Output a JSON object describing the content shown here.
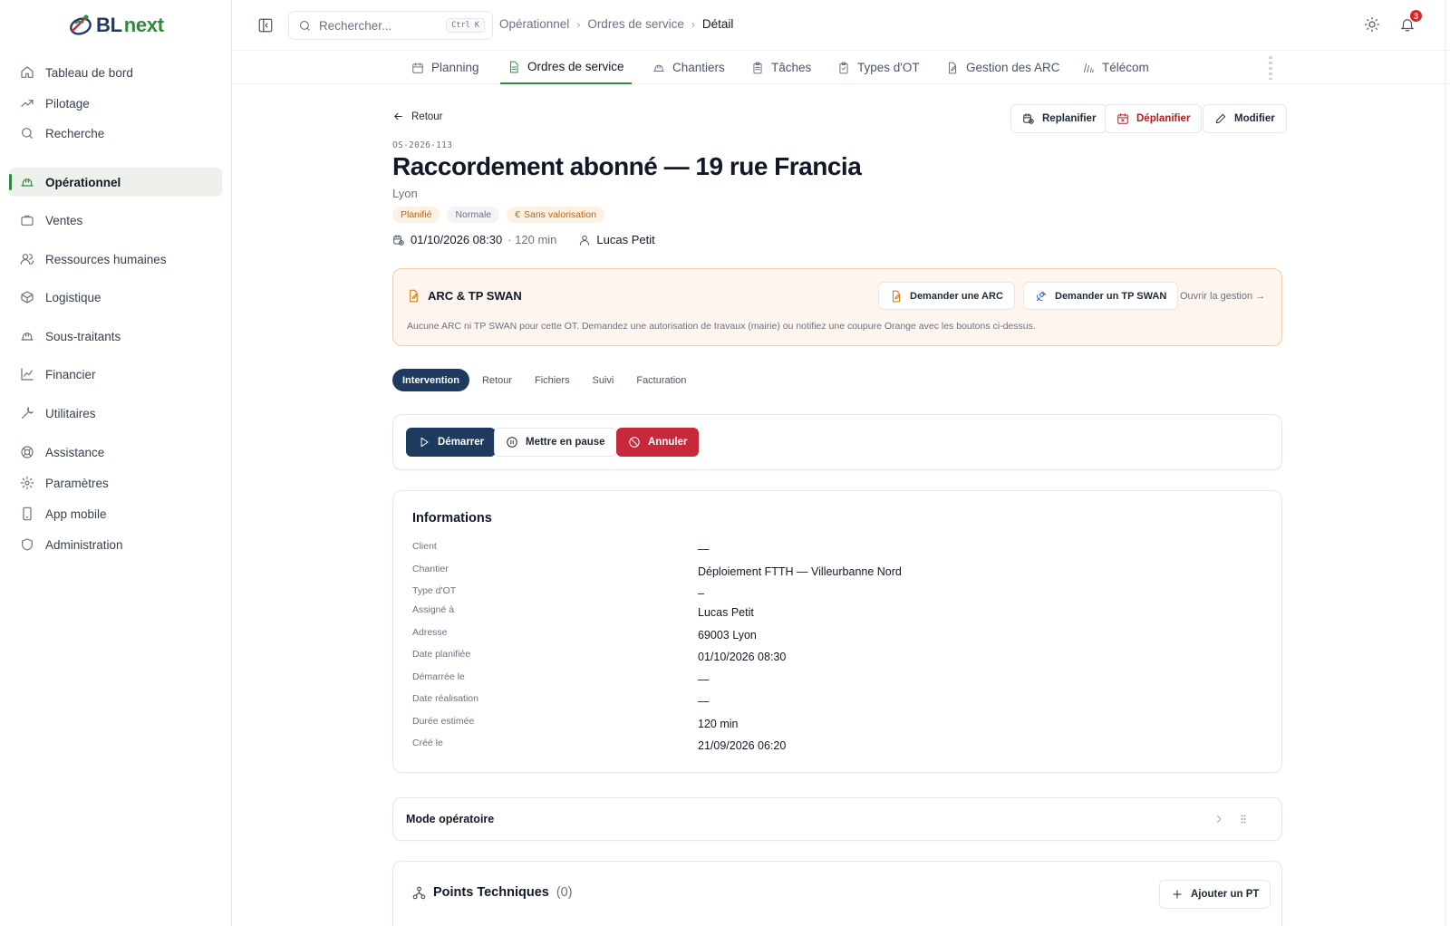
{
  "app": {
    "brand_prefix": "BL",
    "brand_suffix": "next",
    "accent": "#2f8a3c",
    "navy": "#1f3a5f"
  },
  "sidebar": {
    "items": [
      {
        "label": "Tableau de bord",
        "icon": "home-icon"
      },
      {
        "label": "Pilotage",
        "icon": "trend-icon"
      },
      {
        "label": "Recherche",
        "icon": "search-icon"
      },
      {
        "label": "Opérationnel",
        "icon": "hard-hat-icon",
        "active": true
      },
      {
        "label": "Ventes",
        "icon": "briefcase-icon"
      },
      {
        "label": "Ressources humaines",
        "icon": "users-icon"
      },
      {
        "label": "Logistique",
        "icon": "package-icon"
      },
      {
        "label": "Sous-traitants",
        "icon": "hard-hat-icon"
      },
      {
        "label": "Financier",
        "icon": "chart-line-icon"
      },
      {
        "label": "Utilitaires",
        "icon": "wrench-icon"
      },
      {
        "label": "Assistance",
        "icon": "lifebuoy-icon"
      },
      {
        "label": "Paramètres",
        "icon": "gear-icon"
      },
      {
        "label": "App mobile",
        "icon": "phone-icon"
      },
      {
        "label": "Administration",
        "icon": "shield-icon"
      }
    ]
  },
  "topbar": {
    "search_placeholder": "Rechercher...",
    "search_shortcut": "Ctrl K",
    "breadcrumb": [
      "Opérationnel",
      "Ordres de service",
      "Détail"
    ],
    "notifications_count": "3"
  },
  "subnav": {
    "tabs": [
      {
        "label": "Planning",
        "icon": "calendar-icon"
      },
      {
        "label": "Ordres de service",
        "icon": "file-icon",
        "active": true
      },
      {
        "label": "Chantiers",
        "icon": "hard-hat-icon"
      },
      {
        "label": "Tâches",
        "icon": "clipboard-icon"
      },
      {
        "label": "Types d'OT",
        "icon": "clipboard-check-icon"
      },
      {
        "label": "Gestion des ARC",
        "icon": "file-edit-icon"
      },
      {
        "label": "Télécom",
        "icon": "signal-icon"
      }
    ]
  },
  "order": {
    "back_label": "Retour",
    "actions": {
      "replan": "Replanifier",
      "unplan": "Déplanifier",
      "edit": "Modifier"
    },
    "reference": "OS-2026-113",
    "title": "Raccordement abonné — 19 rue Francia",
    "city": "Lyon",
    "badges": {
      "status": "Planifié",
      "priority": "Normale",
      "valuation": "Sans valorisation",
      "valuation_symbol": "€"
    },
    "meta": {
      "datetime": "01/10/2026 08:30",
      "duration": "· 120 min",
      "assignee": "Lucas Petit"
    }
  },
  "arc": {
    "title": "ARC & TP SWAN",
    "request_arc": "Demander une ARC",
    "request_swan": "Demander un TP SWAN",
    "open_link": "Ouvrir la gestion →",
    "description": "Aucune ARC ni TP SWAN pour cette OT. Demandez une autorisation de travaux (mairie) ou notifiez une coupure Orange avec les boutons ci-dessus."
  },
  "detail_tabs": [
    {
      "label": "Intervention",
      "active": true
    },
    {
      "label": "Retour"
    },
    {
      "label": "Fichiers"
    },
    {
      "label": "Suivi"
    },
    {
      "label": "Facturation"
    }
  ],
  "intervention_actions": {
    "start": "Démarrer",
    "pause": "Mettre en pause",
    "cancel": "Annuler"
  },
  "informations": {
    "title": "Informations",
    "rows": [
      {
        "label": "Client",
        "value": "—"
      },
      {
        "label": "Chantier",
        "value": "Déploiement FTTH — Villeurbanne Nord"
      },
      {
        "label": "Type d'OT",
        "value": "–"
      },
      {
        "label": "Assigné à",
        "value": "Lucas Petit"
      },
      {
        "label": "Adresse",
        "value": "69003 Lyon"
      },
      {
        "label": "Date planifiée",
        "value": "01/10/2026 08:30"
      },
      {
        "label": "Démarrée le",
        "value": "—"
      },
      {
        "label": "Date réalisation",
        "value": "—"
      },
      {
        "label": "Durée estimée",
        "value": "120 min"
      },
      {
        "label": "Créé le",
        "value": "21/09/2026 06:20"
      }
    ]
  },
  "mode_operatoire": {
    "title": "Mode opératoire"
  },
  "points_techniques": {
    "title": "Points Techniques",
    "count": "(0)",
    "add_label": "Ajouter un PT"
  }
}
